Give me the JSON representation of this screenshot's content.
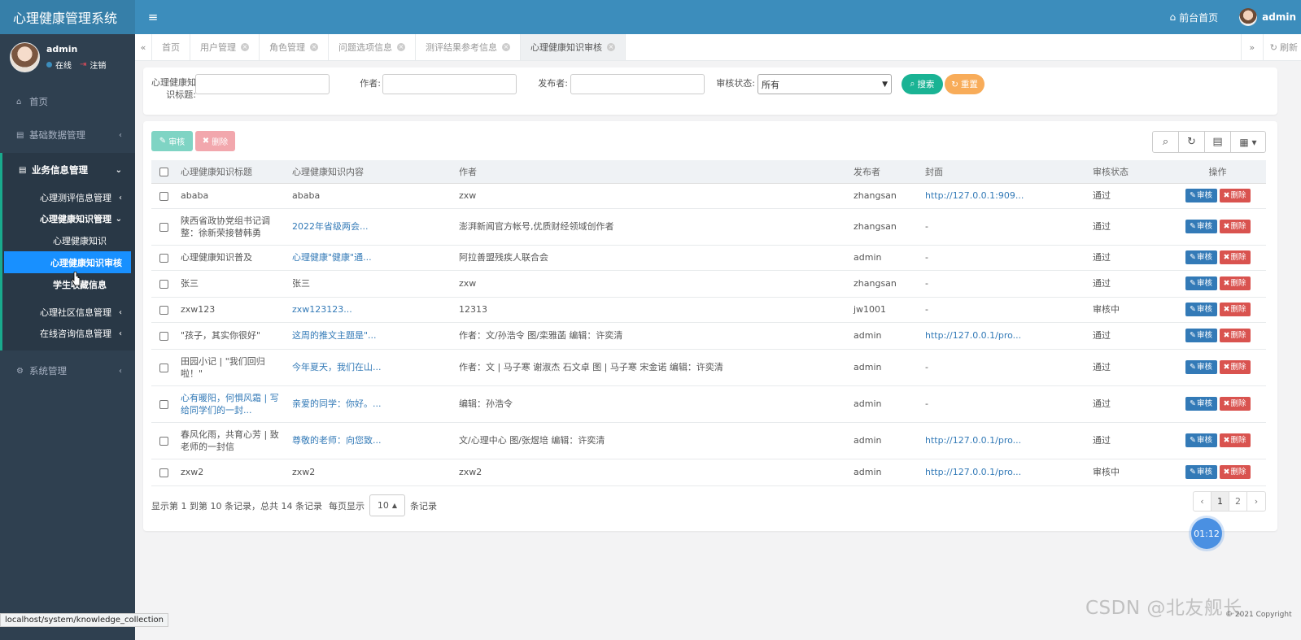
{
  "header": {
    "app_title": "心理健康管理系统",
    "front_home": "前台首页",
    "username": "admin"
  },
  "sidebar": {
    "user": {
      "name": "admin",
      "status": "在线",
      "logout": "注销"
    },
    "items": {
      "home": "首页",
      "basic_data": "基础数据管理",
      "business": "业务信息管理",
      "assessment": "心理测评信息管理",
      "knowledge_mgmt": "心理健康知识管理",
      "knowledge": "心理健康知识",
      "knowledge_audit": "心理健康知识审核",
      "student_collect": "学生收藏信息",
      "community": "心理社区信息管理",
      "consult": "在线咨询信息管理",
      "system": "系统管理"
    }
  },
  "tabs": {
    "items": [
      "首页",
      "用户管理",
      "角色管理",
      "问题选项信息",
      "测评结果参考信息",
      "心理健康知识审核"
    ],
    "refresh": "刷新"
  },
  "search": {
    "title_label": "心理健康知识标题:",
    "author_label": "作者:",
    "publisher_label": "发布者:",
    "status_label": "审核状态:",
    "status_value": "所有",
    "search_btn": "搜索",
    "reset_btn": "重置"
  },
  "toolbar": {
    "audit": "审核",
    "delete": "删除"
  },
  "table": {
    "headers": [
      "心理健康知识标题",
      "心理健康知识内容",
      "作者",
      "发布者",
      "封面",
      "审核状态",
      "操作"
    ],
    "rows": [
      {
        "title": "ababa",
        "content": "ababa",
        "author": "zxw",
        "publisher": "zhangsan",
        "cover": "http://127.0.0.1:909...",
        "status": "通过"
      },
      {
        "title": "陕西省政协党组书记调整：徐新荣接替韩勇",
        "content": "2022年省级两会...",
        "author": "澎湃新闻官方帐号,优质财经领域创作者",
        "publisher": "zhangsan",
        "cover": "-",
        "status": "通过"
      },
      {
        "title": "心理健康知识普及",
        "content": "心理健康\"健康\"通...",
        "author": "阿拉善盟残疾人联合会",
        "publisher": "admin",
        "cover": "-",
        "status": "通过"
      },
      {
        "title": "张三",
        "content": "张三",
        "author": "zxw",
        "publisher": "zhangsan",
        "cover": "-",
        "status": "通过"
      },
      {
        "title": "zxw123",
        "content": "zxw123123...",
        "author": "12313",
        "publisher": "jw1001",
        "cover": "-",
        "status": "审核中"
      },
      {
        "title": "\"孩子，其实你很好\"",
        "content": "这周的推文主题是\"...",
        "author": "作者：文/孙浩令 图/栾雅菡 编辑：许奕清",
        "publisher": "admin",
        "cover": "http://127.0.0.1/pro...",
        "status": "通过"
      },
      {
        "title": "田园小记 | \"我们回归啦！\"",
        "content": "今年夏天，我们在山...",
        "author": "作者：文 | 马子寒 谢淑杰 石文卓 图 | 马子寒 宋金诺 编辑：许奕清",
        "publisher": "admin",
        "cover": "-",
        "status": "通过"
      },
      {
        "title": "心有暖阳，何惧风霜 | 写给同学们的一封...",
        "content": "亲爱的同学：你好。...",
        "author": "编辑：孙浩令",
        "publisher": "admin",
        "cover": "-",
        "status": "通过"
      },
      {
        "title": "春风化雨，共育心芳 | 致老师的一封信",
        "content": "尊敬的老师：向您致...",
        "author": "文/心理中心 图/张煜培 编辑：许奕清",
        "publisher": "admin",
        "cover": "http://127.0.0.1/pro...",
        "status": "通过"
      },
      {
        "title": "zxw2",
        "content": "zxw2",
        "author": "zxw2",
        "publisher": "admin",
        "cover": "http://127.0.0.1/pro...",
        "status": "审核中"
      }
    ],
    "row_audit": "审核",
    "row_delete": "删除"
  },
  "pagination": {
    "info_prefix": "显示第 1 到第 10 条记录，总共 14 条记录",
    "per_page_prefix": "每页显示",
    "page_size": "10",
    "per_page_suffix": "条记录",
    "prev": "‹",
    "pages": [
      "1",
      "2"
    ],
    "next": "›"
  },
  "timer": "01:12",
  "status_url": "localhost/system/knowledge_collection",
  "watermark": "CSDN @北友舰长",
  "copyright": "© 2021 Copyright"
}
